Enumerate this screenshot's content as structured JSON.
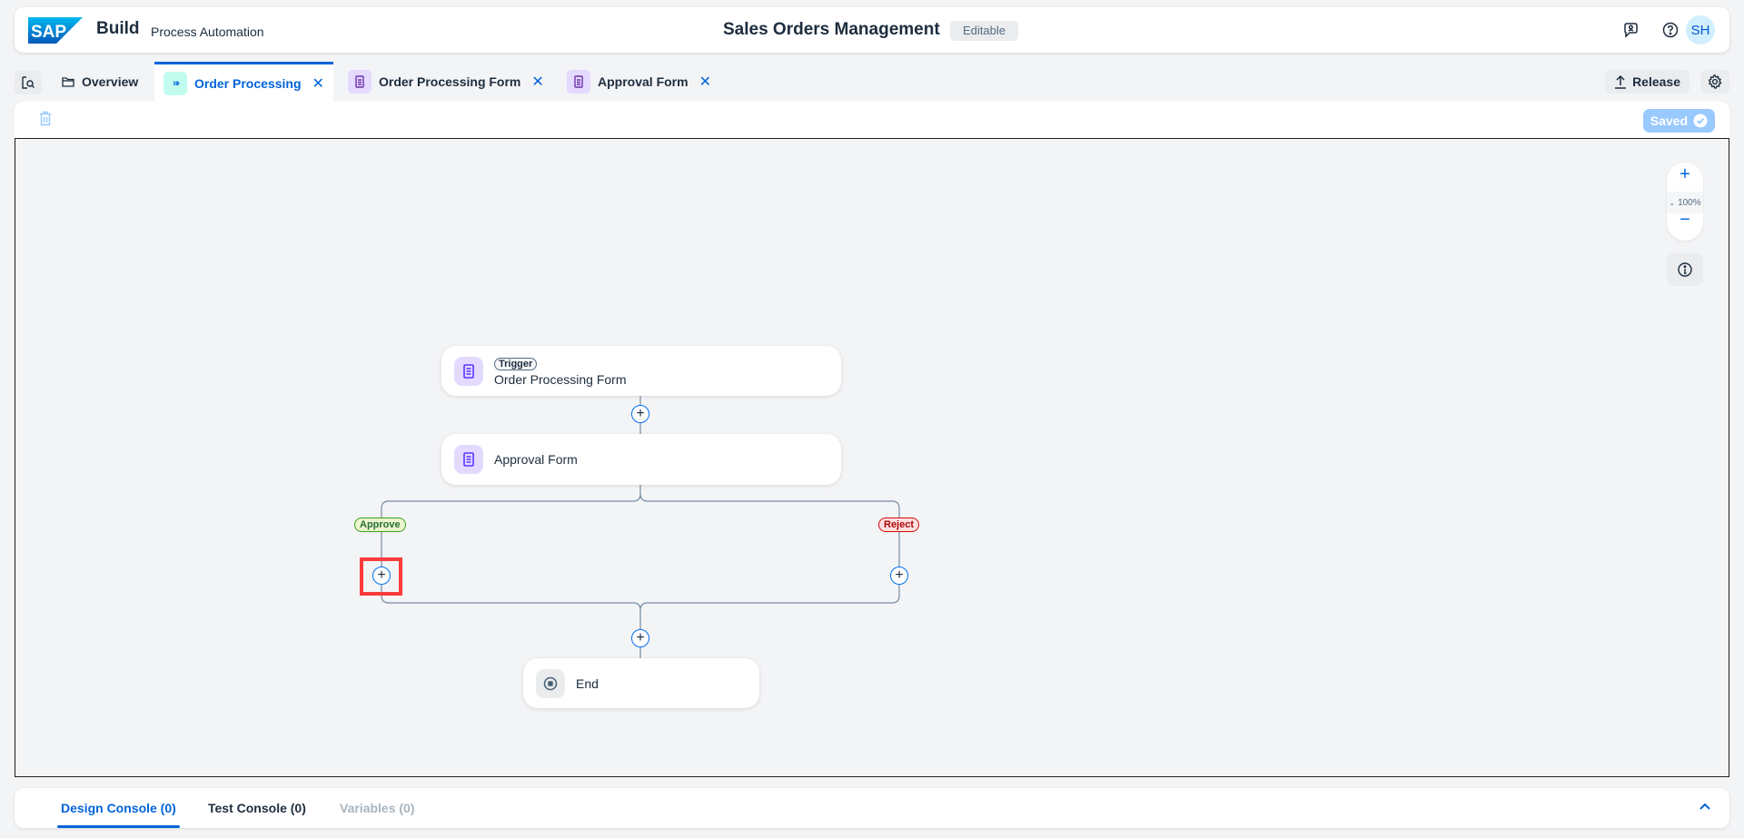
{
  "header": {
    "logo": "SAP",
    "brand": "Build",
    "product": "Process Automation",
    "title": "Sales Orders Management",
    "status_badge": "Editable",
    "icons": [
      "feedback-icon",
      "help-icon"
    ],
    "avatar_initials": "SH"
  },
  "tabs": {
    "items": [
      {
        "label": "Overview",
        "icon": "folder-icon",
        "closable": false,
        "active": false
      },
      {
        "label": "Order Processing",
        "icon": "process-icon",
        "closable": true,
        "active": true
      },
      {
        "label": "Order Processing Form",
        "icon": "form-icon",
        "closable": true,
        "active": false
      },
      {
        "label": "Approval Form",
        "icon": "form-icon",
        "closable": true,
        "active": false
      }
    ],
    "close_glyph": "✕",
    "release_label": "Release"
  },
  "toolbar": {
    "saved_label": "Saved"
  },
  "canvas": {
    "zoom_level": "100%",
    "zoom_in": "+",
    "zoom_out": "−",
    "nodes": {
      "trigger": {
        "badge": "Trigger",
        "label": "Order Processing Form"
      },
      "approval": {
        "label": "Approval Form"
      },
      "end": {
        "label": "End"
      }
    },
    "branches": {
      "approve": "Approve",
      "reject": "Reject"
    },
    "plus_glyph": "+"
  },
  "console": {
    "tabs": [
      {
        "label": "Design Console (0)",
        "active": true
      },
      {
        "label": "Test Console (0)",
        "active": false
      },
      {
        "label": "Variables (0)",
        "disabled": true
      }
    ]
  },
  "colors": {
    "accent": "#0064d9",
    "approve": "#256f3a",
    "reject": "#aa0808",
    "form_icon_bg": "#e4d9ff",
    "process_icon_bg": "#c2fcee"
  }
}
